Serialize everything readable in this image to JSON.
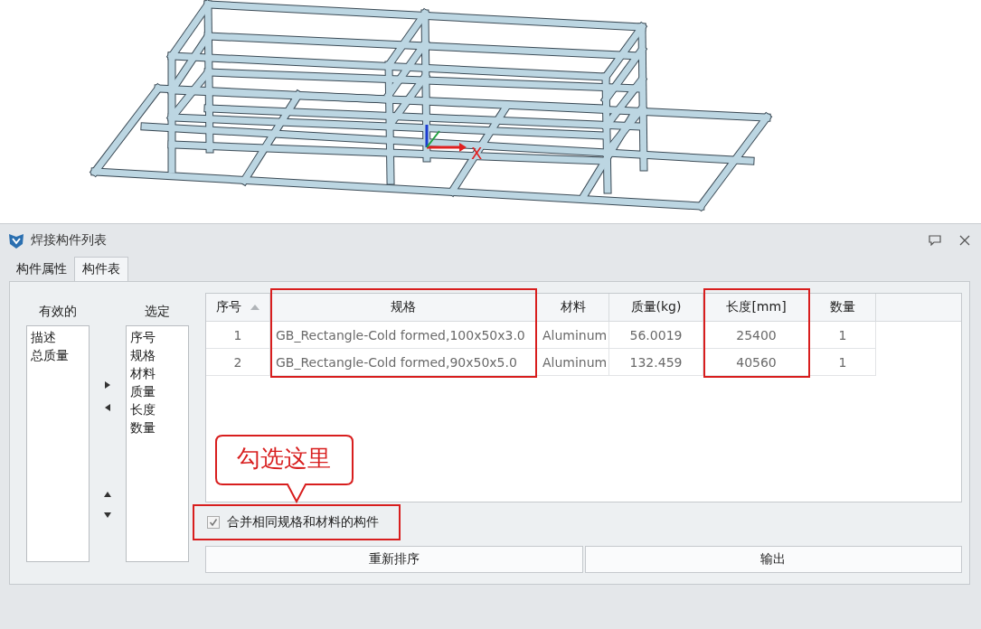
{
  "viewport": {
    "axis_label": "X"
  },
  "dialog": {
    "title": "焊接构件列表",
    "tabs": [
      {
        "label": "构件属性",
        "selected": false
      },
      {
        "label": "构件表",
        "selected": true
      }
    ],
    "available": {
      "heading": "有效的",
      "items": [
        "描述",
        "总质量"
      ]
    },
    "chosen": {
      "heading": "选定",
      "items": [
        "序号",
        "规格",
        "材料",
        "质量",
        "长度",
        "数量"
      ]
    },
    "table": {
      "columns": [
        {
          "label": "序号",
          "sorted": true,
          "highlighted": false
        },
        {
          "label": "规格",
          "sorted": false,
          "highlighted": true
        },
        {
          "label": "材料",
          "sorted": false,
          "highlighted": false
        },
        {
          "label": "质量(kg)",
          "sorted": false,
          "highlighted": false
        },
        {
          "label": "长度[mm]",
          "sorted": false,
          "highlighted": true
        },
        {
          "label": "数量",
          "sorted": false,
          "highlighted": false
        }
      ],
      "rows": [
        [
          "1",
          "GB_Rectangle-Cold formed,100x50x3.0",
          "Aluminum",
          "56.0019",
          "25400",
          "1"
        ],
        [
          "2",
          "GB_Rectangle-Cold formed,90x50x5.0",
          "Aluminum",
          "132.459",
          "40560",
          "1"
        ]
      ]
    },
    "callout": "勾选这里",
    "merge_option": {
      "label": "合并相同规格和材料的构件",
      "checked": true,
      "highlighted": true
    },
    "buttons": [
      "重新排序",
      "输出"
    ]
  }
}
